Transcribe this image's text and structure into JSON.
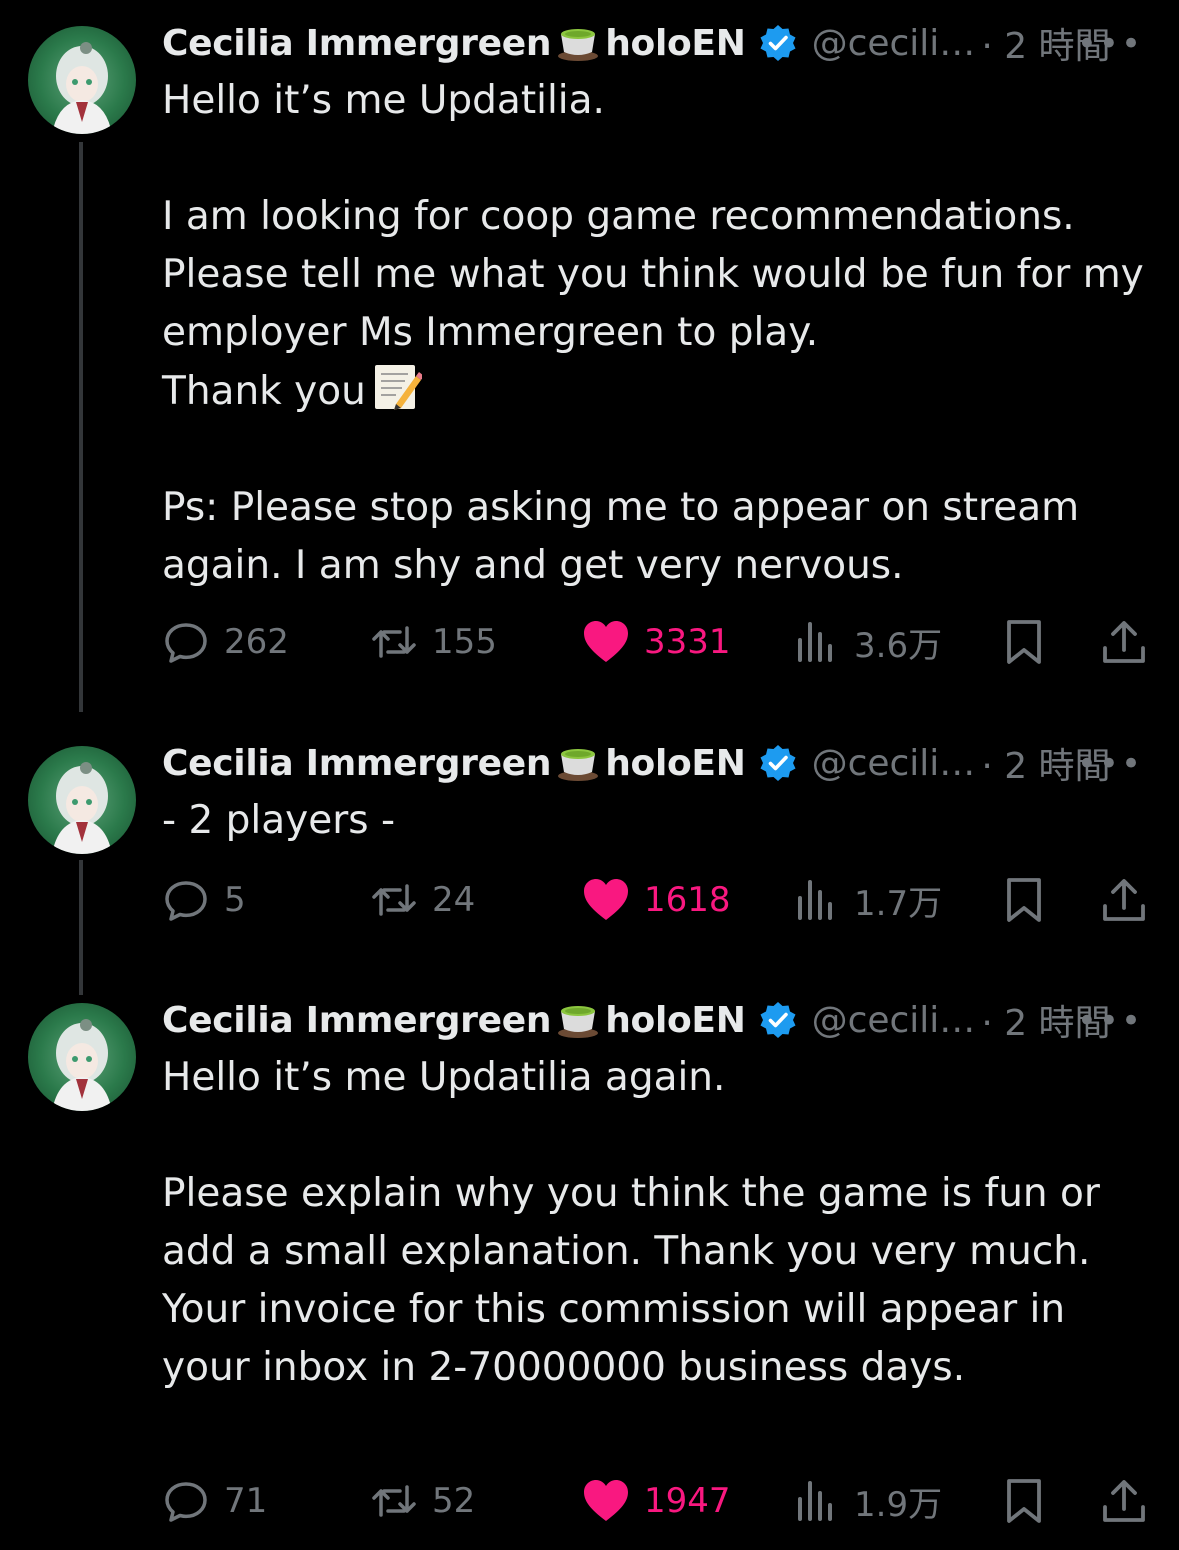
{
  "tweets": [
    {
      "name": "Cecilia Immergreen",
      "name_suffix": "holoEN",
      "handle": "@cecili…",
      "time": "· 2 時間",
      "more": "•••",
      "text": "Hello it’s me Updatilia.\n\nI am looking for coop game recommendations. Please tell me what you think would be fun for my employer Ms Immergreen to play.\nThank you",
      "text_after_emoji": "\n\nPs: Please stop asking me to appear on stream again. I am shy and get very nervous.",
      "emoji": "memo",
      "replies": "262",
      "retweets": "155",
      "likes": "3331",
      "views": "3.6万"
    },
    {
      "name": "Cecilia Immergreen",
      "name_suffix": "holoEN",
      "handle": "@cecili…",
      "time": "· 2 時間",
      "more": "•••",
      "text": "- 2 players -",
      "replies": "5",
      "retweets": "24",
      "likes": "1618",
      "views": "1.7万"
    },
    {
      "name": "Cecilia Immergreen",
      "name_suffix": "holoEN",
      "handle": "@cecili…",
      "time": "· 2 時間",
      "more": "•••",
      "text": "Hello it’s me Updatilia again.\n\nPlease explain why you think the game is fun or add a small explanation. Thank you very much.\nYour invoice for this commission will appear in your inbox in 2-70000000 business days.",
      "replies": "71",
      "retweets": "52",
      "likes": "1947",
      "views": "1.9万"
    }
  ],
  "colors": {
    "background": "#000000",
    "text": "#e7e9ea",
    "muted": "#71767b",
    "like": "#f91880",
    "verified": "#1d9bf0"
  }
}
